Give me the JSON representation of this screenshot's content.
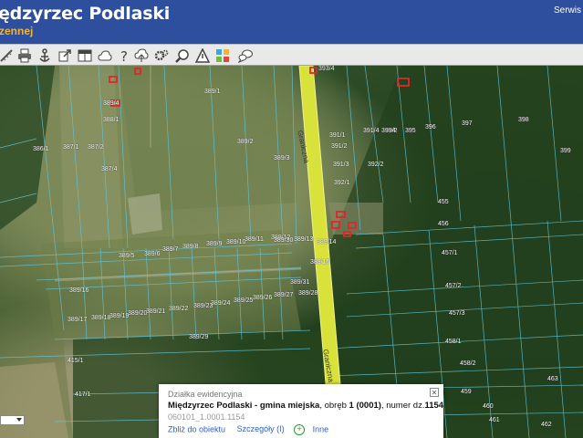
{
  "header": {
    "title": "ędzyrzec Podlaski",
    "subtitle": "zennej",
    "service_link": "Serwis p",
    "colors": {
      "background": "#2d4f9e",
      "title": "#ffffff",
      "subtitle": "#f2b533"
    }
  },
  "toolbar": {
    "tools": [
      "ruler-icon",
      "print-icon",
      "anchor-icon",
      "export-icon",
      "layout-icon",
      "cloud-icon",
      "help-icon",
      "cloud-upload-icon",
      "settings-icon",
      "zoom-search-icon",
      "triangle-warning-icon",
      "layers-grid-icon",
      "speech-bubble-icon"
    ]
  },
  "map": {
    "street_names": [
      "Graniczna",
      "Graniczna"
    ],
    "parcels": [
      "393/4",
      "389/1",
      "388/1",
      "387/1",
      "386/1",
      "387/2",
      "387/4",
      "389/4",
      "389/2",
      "389/3",
      "391/1",
      "391/2",
      "391/3",
      "392/1",
      "391/4",
      "392/2",
      "393/2",
      "394",
      "395",
      "396",
      "397",
      "398",
      "399",
      "455",
      "456",
      "457/1",
      "457/2",
      "457/3",
      "389/5",
      "389/6",
      "389/7",
      "389/8",
      "389/9",
      "389/10",
      "389/11",
      "389/12",
      "389/13",
      "389/14",
      "389/15",
      "389/16",
      "389/17",
      "389/18",
      "389/19",
      "389/20",
      "389/21",
      "389/22",
      "389/23",
      "389/24",
      "389/25",
      "389/26",
      "389/27",
      "389/28",
      "389/29",
      "389/30",
      "389/31",
      "458/1",
      "458/2",
      "459",
      "460",
      "461",
      "462",
      "463",
      "415/1",
      "417/1"
    ]
  },
  "popup": {
    "header": "Działka ewidencyjna",
    "location": "Międzyrzec Podlaski - gmina miejska",
    "line1_mid": ", obręb ",
    "obreb": "1 (0001)",
    "line1_tail": ", numer dz.",
    "parcel_no": "1154",
    "code": "060101_1.0001.1154",
    "zoom_link": "Zbliż do obiektu",
    "details_link": "Szczegóły (I)",
    "other_link": "Inne",
    "close_symbol": "✕"
  }
}
